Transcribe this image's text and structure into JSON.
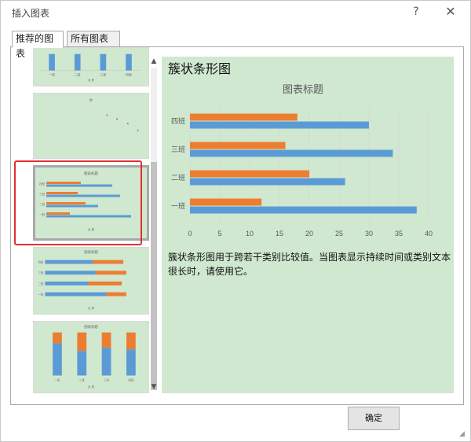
{
  "window": {
    "title": "插入图表",
    "help_glyph": "?",
    "close_glyph": "✕"
  },
  "tabs": [
    {
      "label": "推荐的图表"
    },
    {
      "label": "所有图表"
    }
  ],
  "scrollbar": {
    "up_glyph": "▲",
    "down_glyph": "▼"
  },
  "thumbnails": {
    "thumb1": {
      "categories": [
        "一班",
        "二班",
        "三班",
        "四班"
      ],
      "legend": "女 男"
    },
    "thumb2": {
      "title": "女"
    },
    "thumb3": {
      "title": "图表标题",
      "categories": [
        "一班",
        "二班",
        "三班",
        "四班"
      ],
      "legend": "女 男"
    },
    "thumb4": {
      "title": "图表标题",
      "categories": [
        "一班",
        "二班",
        "三班",
        "四班"
      ],
      "legend": "女 男"
    },
    "thumb5": {
      "title": "图表标题",
      "categories": [
        "一班",
        "二班",
        "三班",
        "四班"
      ],
      "legend": "女 男"
    }
  },
  "preview": {
    "title": "簇状条形图",
    "description": "簇状条形图用于跨若干类别比较值。当图表显示持续时间或类别文本很长时，请使用它。"
  },
  "chart_data": {
    "type": "bar",
    "orientation": "horizontal",
    "title": "图表标题",
    "categories": [
      "一班",
      "二班",
      "三班",
      "四班"
    ],
    "series": [
      {
        "name": "女",
        "values": [
          12,
          20,
          16,
          18
        ],
        "color": "#ed7d31"
      },
      {
        "name": "男",
        "values": [
          38,
          26,
          34,
          30
        ],
        "color": "#5b9bd5"
      }
    ],
    "xlim": [
      0,
      40
    ],
    "xticks": [
      0,
      5,
      10,
      15,
      20,
      25,
      30,
      35,
      40
    ],
    "grid": true,
    "legend_position": "bottom"
  },
  "footer": {
    "ok_label": "确定"
  }
}
